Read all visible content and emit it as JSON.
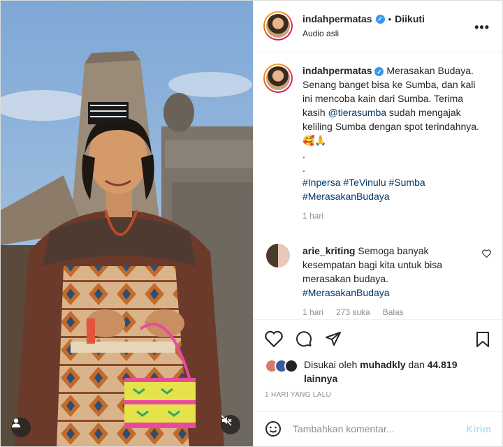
{
  "post": {
    "username": "indahpermatas",
    "follow_status": "Diikuti",
    "audio": "Audio asli",
    "separator": "•",
    "more": "•••"
  },
  "caption": {
    "username": "indahpermatas",
    "text": "Merasakan Budaya. Senang banget bisa ke Sumba, dan kali ini mencoba kain dari Sumba. Terima kasih ",
    "mention": "@tierasumba",
    "text2": " sudah mengajak keliling Sumba dengan spot terindahnya. 🥰🙏",
    "dot1": ".",
    "dot2": ".",
    "hashtags1": "#Inpersa #TeVinulu #Sumba",
    "hashtags2": "#MerasakanBudaya",
    "time": "1 hari"
  },
  "comment": {
    "username": "arie_kriting",
    "text": "Semoga banyak kesempatan bagi kita untuk bisa merasakan budaya.",
    "hashtag": "#MerasakanBudaya",
    "time": "1 hari",
    "likes": "273 suka",
    "reply": "Balas"
  },
  "likes": {
    "prefix": "Disukai oleh ",
    "user": "muhadkly",
    "middle": " dan ",
    "count": "44.819",
    "suffix": " lainnya"
  },
  "date": "1 HARI YANG LALU",
  "add_comment": {
    "placeholder": "Tambahkan komentar...",
    "post_label": "Kirim"
  },
  "icons": {
    "heart": "heart-icon",
    "comment": "comment-icon",
    "share": "share-icon",
    "bookmark": "bookmark-icon",
    "emoji": "emoji-icon",
    "user": "user-icon",
    "mute": "mute-icon"
  },
  "colors": {
    "verified": "#3897f0",
    "link": "#00376b",
    "muted": "#8e8e8e",
    "post_button": "#b2dffc"
  }
}
